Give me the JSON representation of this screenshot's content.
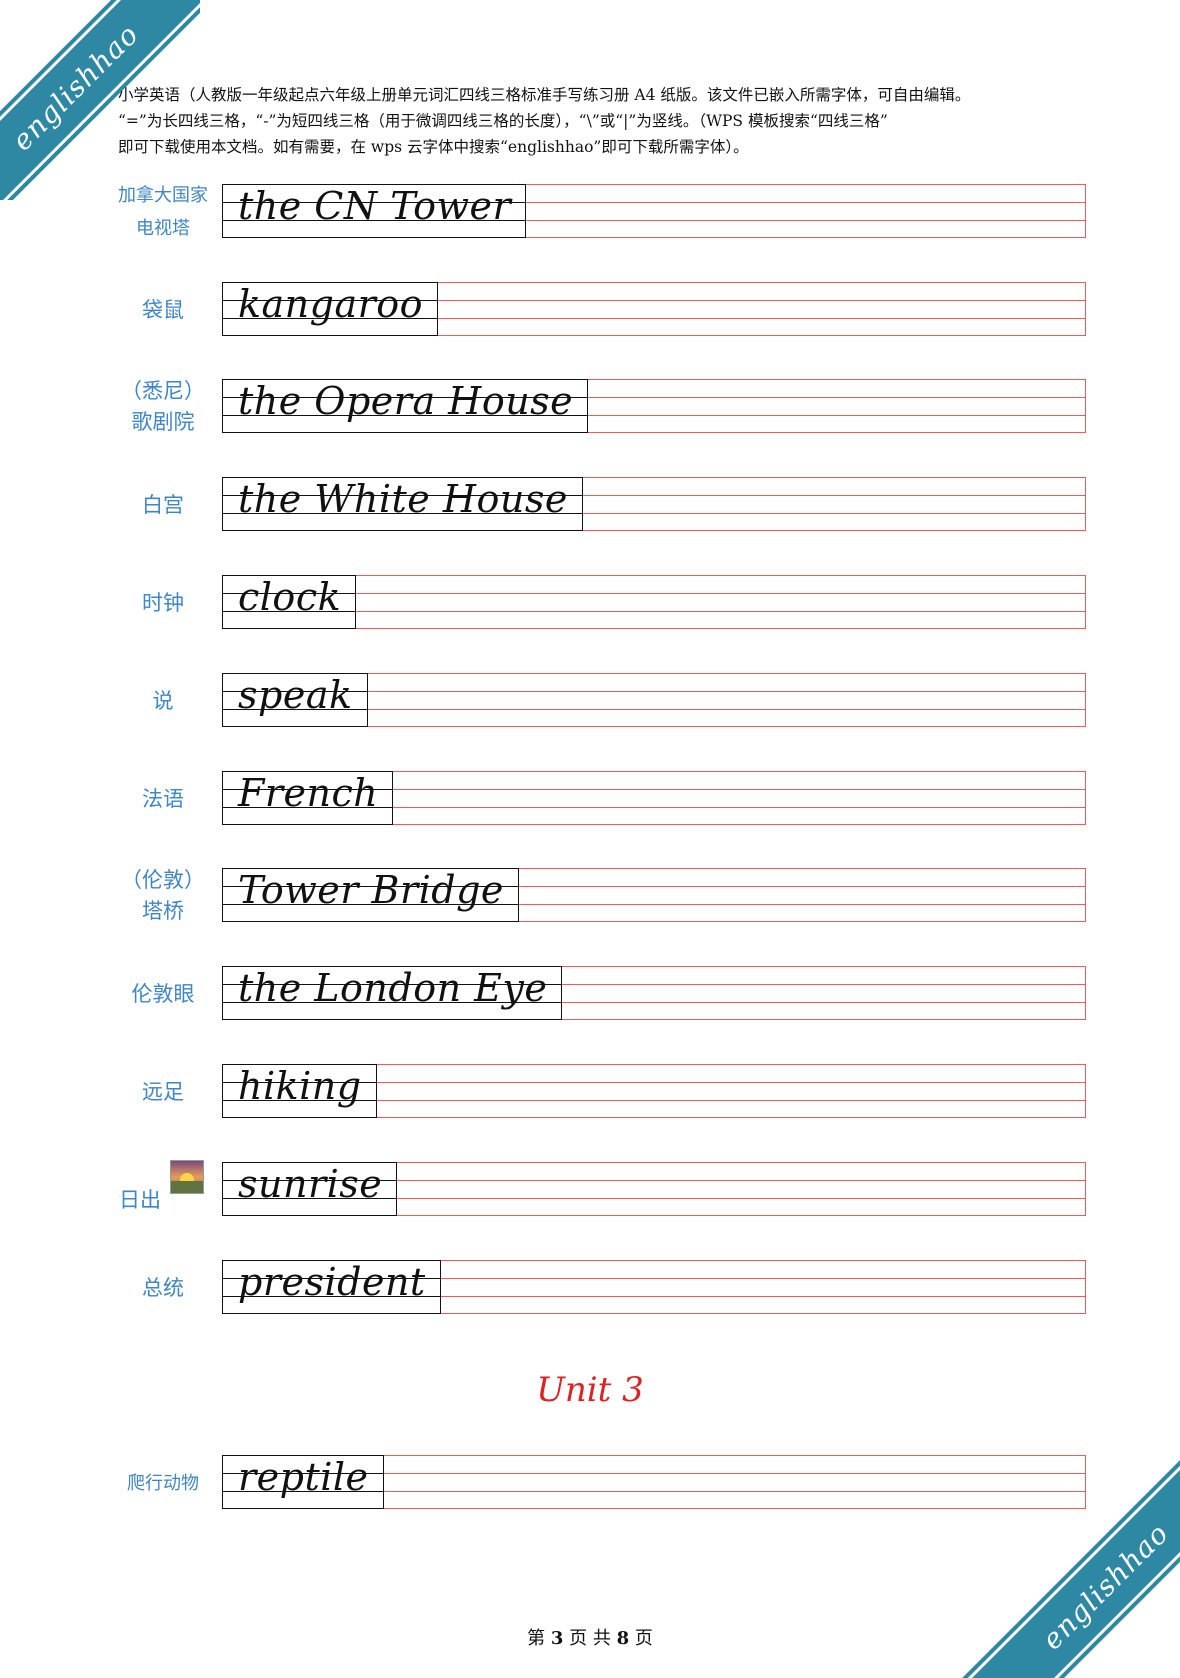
{
  "watermark": {
    "text": "englishhao",
    "color": "#2e87a3"
  },
  "intro": {
    "line1": "小学英语（人教版一年级起点六年级上册单元词汇四线三格标准手写练习册 A4 纸版。该文件已嵌入所需字体，可自由编辑。",
    "line2": "“=”为长四线三格，“-”为短四线三格（用于微调四线三格的长度），“\\”或“|”为竖线。（WPS 模板搜索“四线三格”",
    "line3": "即可下载使用本文档。如有需要，在 wps 云字体中搜索“englishhao”即可下载所需字体）。"
  },
  "colors": {
    "label": "#3f85c7",
    "grid_line": "#ef5a5a",
    "unit_heading": "#dd2222"
  },
  "entries": [
    {
      "label": "加拿大国家\n电视塔",
      "word": "the CN Tower"
    },
    {
      "label": "袋鼠",
      "word": "kangaroo"
    },
    {
      "label": "（悉尼）\n歌剧院",
      "word": "the Opera House"
    },
    {
      "label": "白宫",
      "word": "the White House"
    },
    {
      "label": "时钟",
      "word": "clock"
    },
    {
      "label": "说",
      "word": "speak"
    },
    {
      "label": "法语",
      "word": "French"
    },
    {
      "label": "（伦敦）\n塔桥",
      "word": "Tower Bridge"
    },
    {
      "label": "伦敦眼",
      "word": "the London Eye"
    },
    {
      "label": "远足",
      "word": "hiking"
    },
    {
      "label": "日出",
      "word": "sunrise",
      "icon": "sunrise-icon"
    },
    {
      "label": "总统",
      "word": "president"
    },
    {
      "label": "爬行动物",
      "word": "reptile"
    }
  ],
  "unit_heading": "Unit 3",
  "footer": {
    "prefix": "第",
    "current": "3",
    "middle": "页 共",
    "total": "8",
    "suffix": "页"
  }
}
